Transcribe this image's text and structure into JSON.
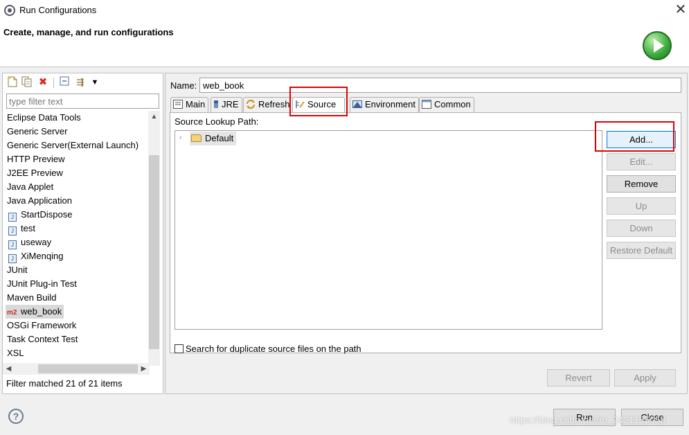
{
  "window": {
    "title": "Run Configurations",
    "close_glyph": "✕",
    "banner_title": "Create, manage, and run configurations",
    "banner_icon": "run-play-icon"
  },
  "sidebar": {
    "toolbar": [
      {
        "name": "new-config-icon",
        "glyph": "🗋"
      },
      {
        "name": "duplicate-config-icon",
        "glyph": "⧉"
      },
      {
        "name": "delete-config-icon",
        "glyph": "✖"
      },
      {
        "name": "collapse-all-icon",
        "glyph": "⊟"
      },
      {
        "name": "filter-icon",
        "glyph": "⇶"
      },
      {
        "name": "view-menu-icon",
        "glyph": "▾"
      }
    ],
    "filter_placeholder": "type filter text",
    "items": [
      {
        "label": "Eclipse Data Tools",
        "icon": ""
      },
      {
        "label": "Generic Server",
        "icon": ""
      },
      {
        "label": "Generic Server(External Launch)",
        "icon": ""
      },
      {
        "label": "HTTP Preview",
        "icon": ""
      },
      {
        "label": "J2EE Preview",
        "icon": ""
      },
      {
        "label": "Java Applet",
        "icon": ""
      },
      {
        "label": "Java Application",
        "icon": ""
      },
      {
        "label": "StartDispose",
        "icon": "java-class-icon"
      },
      {
        "label": "test",
        "icon": "java-class-icon"
      },
      {
        "label": "useway",
        "icon": "java-class-icon"
      },
      {
        "label": "XiMenqing",
        "icon": "java-class-icon"
      },
      {
        "label": "JUnit",
        "icon": ""
      },
      {
        "label": "JUnit Plug-in Test",
        "icon": ""
      },
      {
        "label": "Maven Build",
        "icon": ""
      },
      {
        "label": "web_book",
        "icon": "maven-m2-icon",
        "selected": true
      },
      {
        "label": "OSGi Framework",
        "icon": ""
      },
      {
        "label": "Task Context Test",
        "icon": ""
      },
      {
        "label": "XSL",
        "icon": ""
      }
    ],
    "m2_text": "m2",
    "j_text": "J",
    "filter_status": "Filter matched 21 of 21 items"
  },
  "config": {
    "name_label": "Name:",
    "name_value": "web_book",
    "tabs": [
      {
        "label": "Main",
        "icon": "main-tab-icon"
      },
      {
        "label": "JRE",
        "icon": "jre-tab-icon"
      },
      {
        "label": "Refresh",
        "icon": "refresh-tab-icon"
      },
      {
        "label": "Source",
        "icon": "source-tab-icon",
        "active": true
      },
      {
        "label": "Environment",
        "icon": "environment-tab-icon"
      },
      {
        "label": "Common",
        "icon": "common-tab-icon"
      }
    ],
    "lookup_label": "Source Lookup Path:",
    "tree": {
      "expander": "›",
      "default_label": "Default"
    },
    "side_buttons": {
      "add": "Add...",
      "edit": "Edit...",
      "remove": "Remove",
      "up": "Up",
      "down": "Down",
      "restore": "Restore Default"
    },
    "duplicate_check_label": "Search for duplicate source files on the path",
    "duplicate_checked": false,
    "revert": "Revert",
    "apply": "Apply"
  },
  "footer": {
    "help_glyph": "?",
    "run": "Run",
    "close": "Close",
    "watermark": "https://blog.csdn.net/m_2421155058"
  },
  "colors": {
    "highlight": "#e00000",
    "accent": "#0078d7"
  }
}
